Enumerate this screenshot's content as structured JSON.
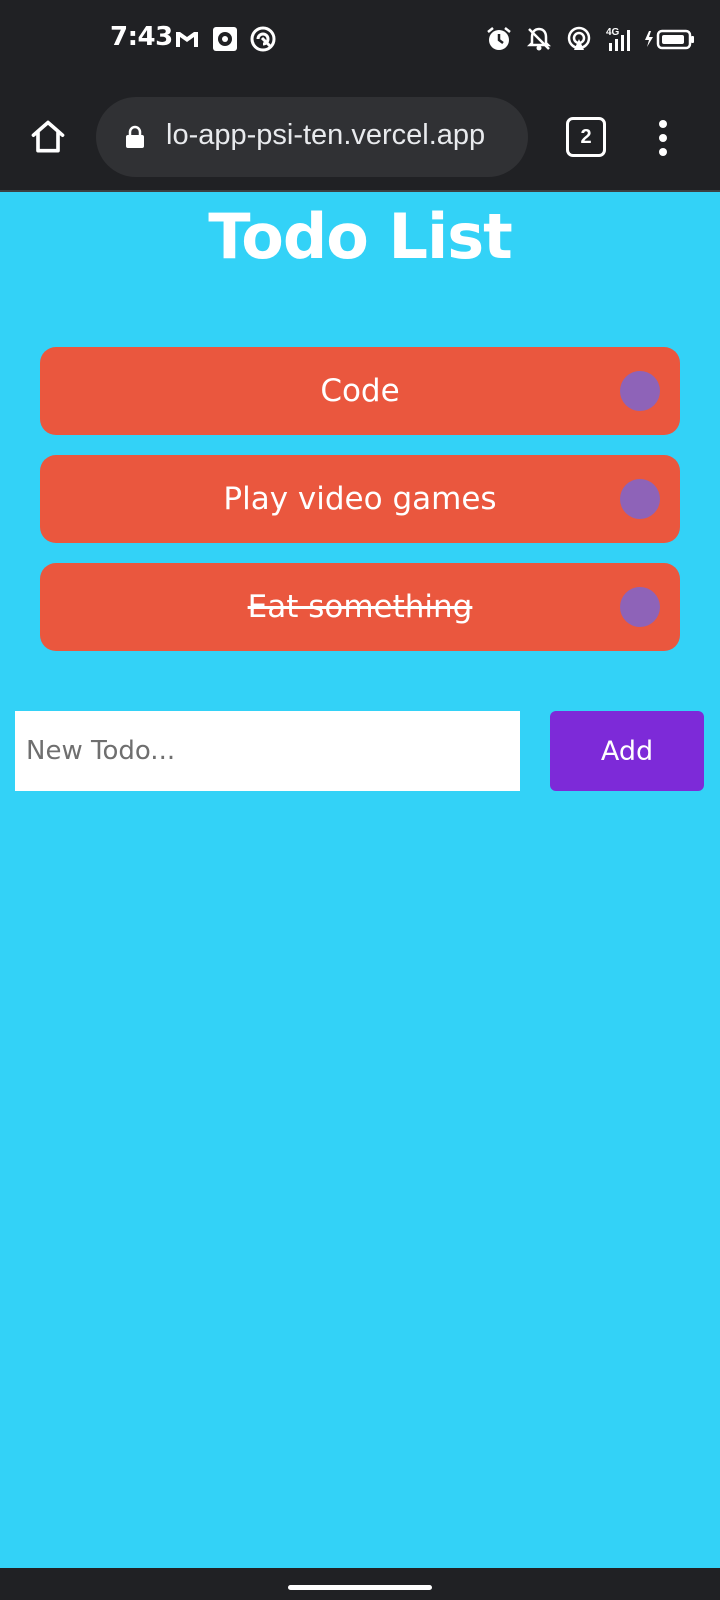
{
  "status_bar": {
    "time": "7:43",
    "left_icons": [
      "gmail-icon",
      "music-app-icon",
      "vpn-app-icon"
    ],
    "right_icons": [
      "alarm-icon",
      "notifications-off-icon",
      "hotspot-icon",
      "signal-4g-icon",
      "battery-charging-icon"
    ],
    "signal_label": "4G"
  },
  "browser": {
    "url": "lo-app-psi-ten.vercel.app",
    "tab_count": "2"
  },
  "app": {
    "title": "Todo List",
    "todos": [
      {
        "text": "Code",
        "done": false
      },
      {
        "text": "Play video games",
        "done": false
      },
      {
        "text": "Eat something",
        "done": true
      }
    ],
    "input_placeholder": "New Todo...",
    "input_value": "",
    "add_label": "Add"
  },
  "colors": {
    "background": "#33d2f7",
    "todo_bg": "#ea573e",
    "toggle": "#8e63b8",
    "add_button": "#7d2ad8",
    "chrome": "#202124"
  }
}
